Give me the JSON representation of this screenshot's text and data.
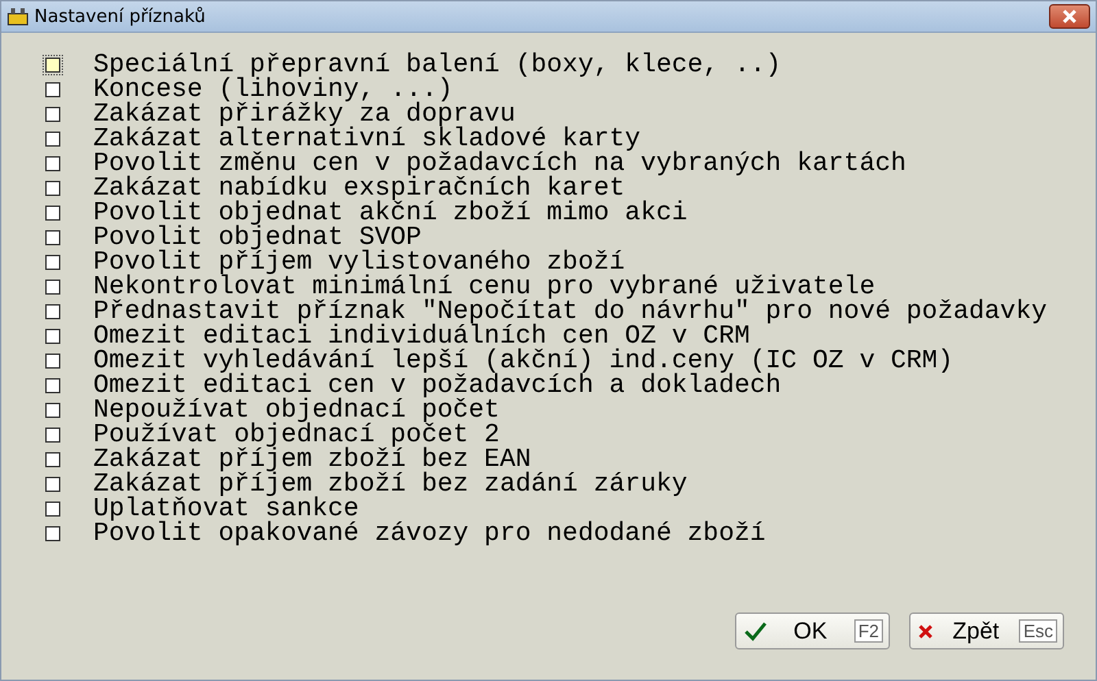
{
  "window": {
    "title": "Nastavení příznaků"
  },
  "options": [
    {
      "label": "Speciální přepravní balení (boxy, klece, ..)",
      "checked": false,
      "focused": true
    },
    {
      "label": "Koncese (lihoviny, ...)",
      "checked": false,
      "focused": false
    },
    {
      "label": "Zakázat přirážky za dopravu",
      "checked": false,
      "focused": false
    },
    {
      "label": "Zakázat alternativní skladové karty",
      "checked": false,
      "focused": false
    },
    {
      "label": "Povolit změnu cen v požadavcích na vybraných kartách",
      "checked": false,
      "focused": false
    },
    {
      "label": "Zakázat nabídku exspiračních karet",
      "checked": false,
      "focused": false
    },
    {
      "label": "Povolit objednat akční zboží mimo akci",
      "checked": false,
      "focused": false
    },
    {
      "label": "Povolit objednat SVOP",
      "checked": false,
      "focused": false
    },
    {
      "label": "Povolit příjem vylistovaného zboží",
      "checked": false,
      "focused": false
    },
    {
      "label": "Nekontrolovat minimální cenu pro vybrané uživatele",
      "checked": false,
      "focused": false
    },
    {
      "label": "Přednastavit příznak \"Nepočítat do návrhu\" pro nové požadavky",
      "checked": false,
      "focused": false
    },
    {
      "label": "Omezit editaci individuálních cen OZ v CRM",
      "checked": false,
      "focused": false
    },
    {
      "label": "Omezit vyhledávání lepší (akční) ind.ceny (IC OZ v CRM)",
      "checked": false,
      "focused": false
    },
    {
      "label": "Omezit editaci cen v požadavcích a dokladech",
      "checked": false,
      "focused": false
    },
    {
      "label": "Nepoužívat objednací počet",
      "checked": false,
      "focused": false
    },
    {
      "label": "Používat objednací počet 2",
      "checked": false,
      "focused": false
    },
    {
      "label": "Zakázat příjem zboží bez EAN",
      "checked": false,
      "focused": false
    },
    {
      "label": "Zakázat příjem zboží bez zadání záruky",
      "checked": false,
      "focused": false
    },
    {
      "label": "Uplatňovat sankce",
      "checked": false,
      "focused": false
    },
    {
      "label": "Povolit opakované závozy pro nedodané zboží",
      "checked": false,
      "focused": false
    }
  ],
  "buttons": [
    {
      "kind": "ok",
      "label": "OK",
      "shortcut": "F2"
    },
    {
      "kind": "back",
      "label": "Zpět",
      "shortcut": "Esc"
    }
  ]
}
